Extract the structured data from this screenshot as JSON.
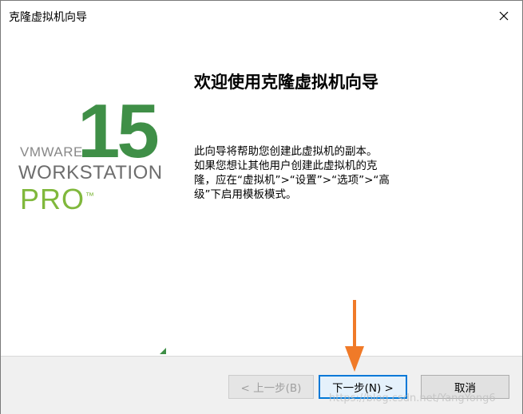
{
  "window": {
    "title": "克隆虚拟机向导",
    "close_icon": "close-icon"
  },
  "logo": {
    "number": "15",
    "brand": "VMWARE",
    "product": "WORKSTATION",
    "edition": "PRO",
    "trademark": "™",
    "colors": {
      "number": "#3f8f47",
      "edition": "#80b83c",
      "text": "#6d6d6d"
    }
  },
  "content": {
    "heading": "欢迎使用克隆虚拟机向导",
    "line1": "此向导将帮助您创建此虚拟机的副本。",
    "line2": "如果您想让其他用户创建此虚拟机的克",
    "line3": "隆，应在“虚拟机”>“设置”>“选项”>“高",
    "line4": "级”下启用模板模式。"
  },
  "buttons": {
    "back": "< 上一步(B)",
    "next": "下一步(N) >",
    "cancel": "取消"
  },
  "annotation": {
    "arrow_color": "#f07a28",
    "watermark": "https://blog.csdn.net/YangYong6"
  }
}
